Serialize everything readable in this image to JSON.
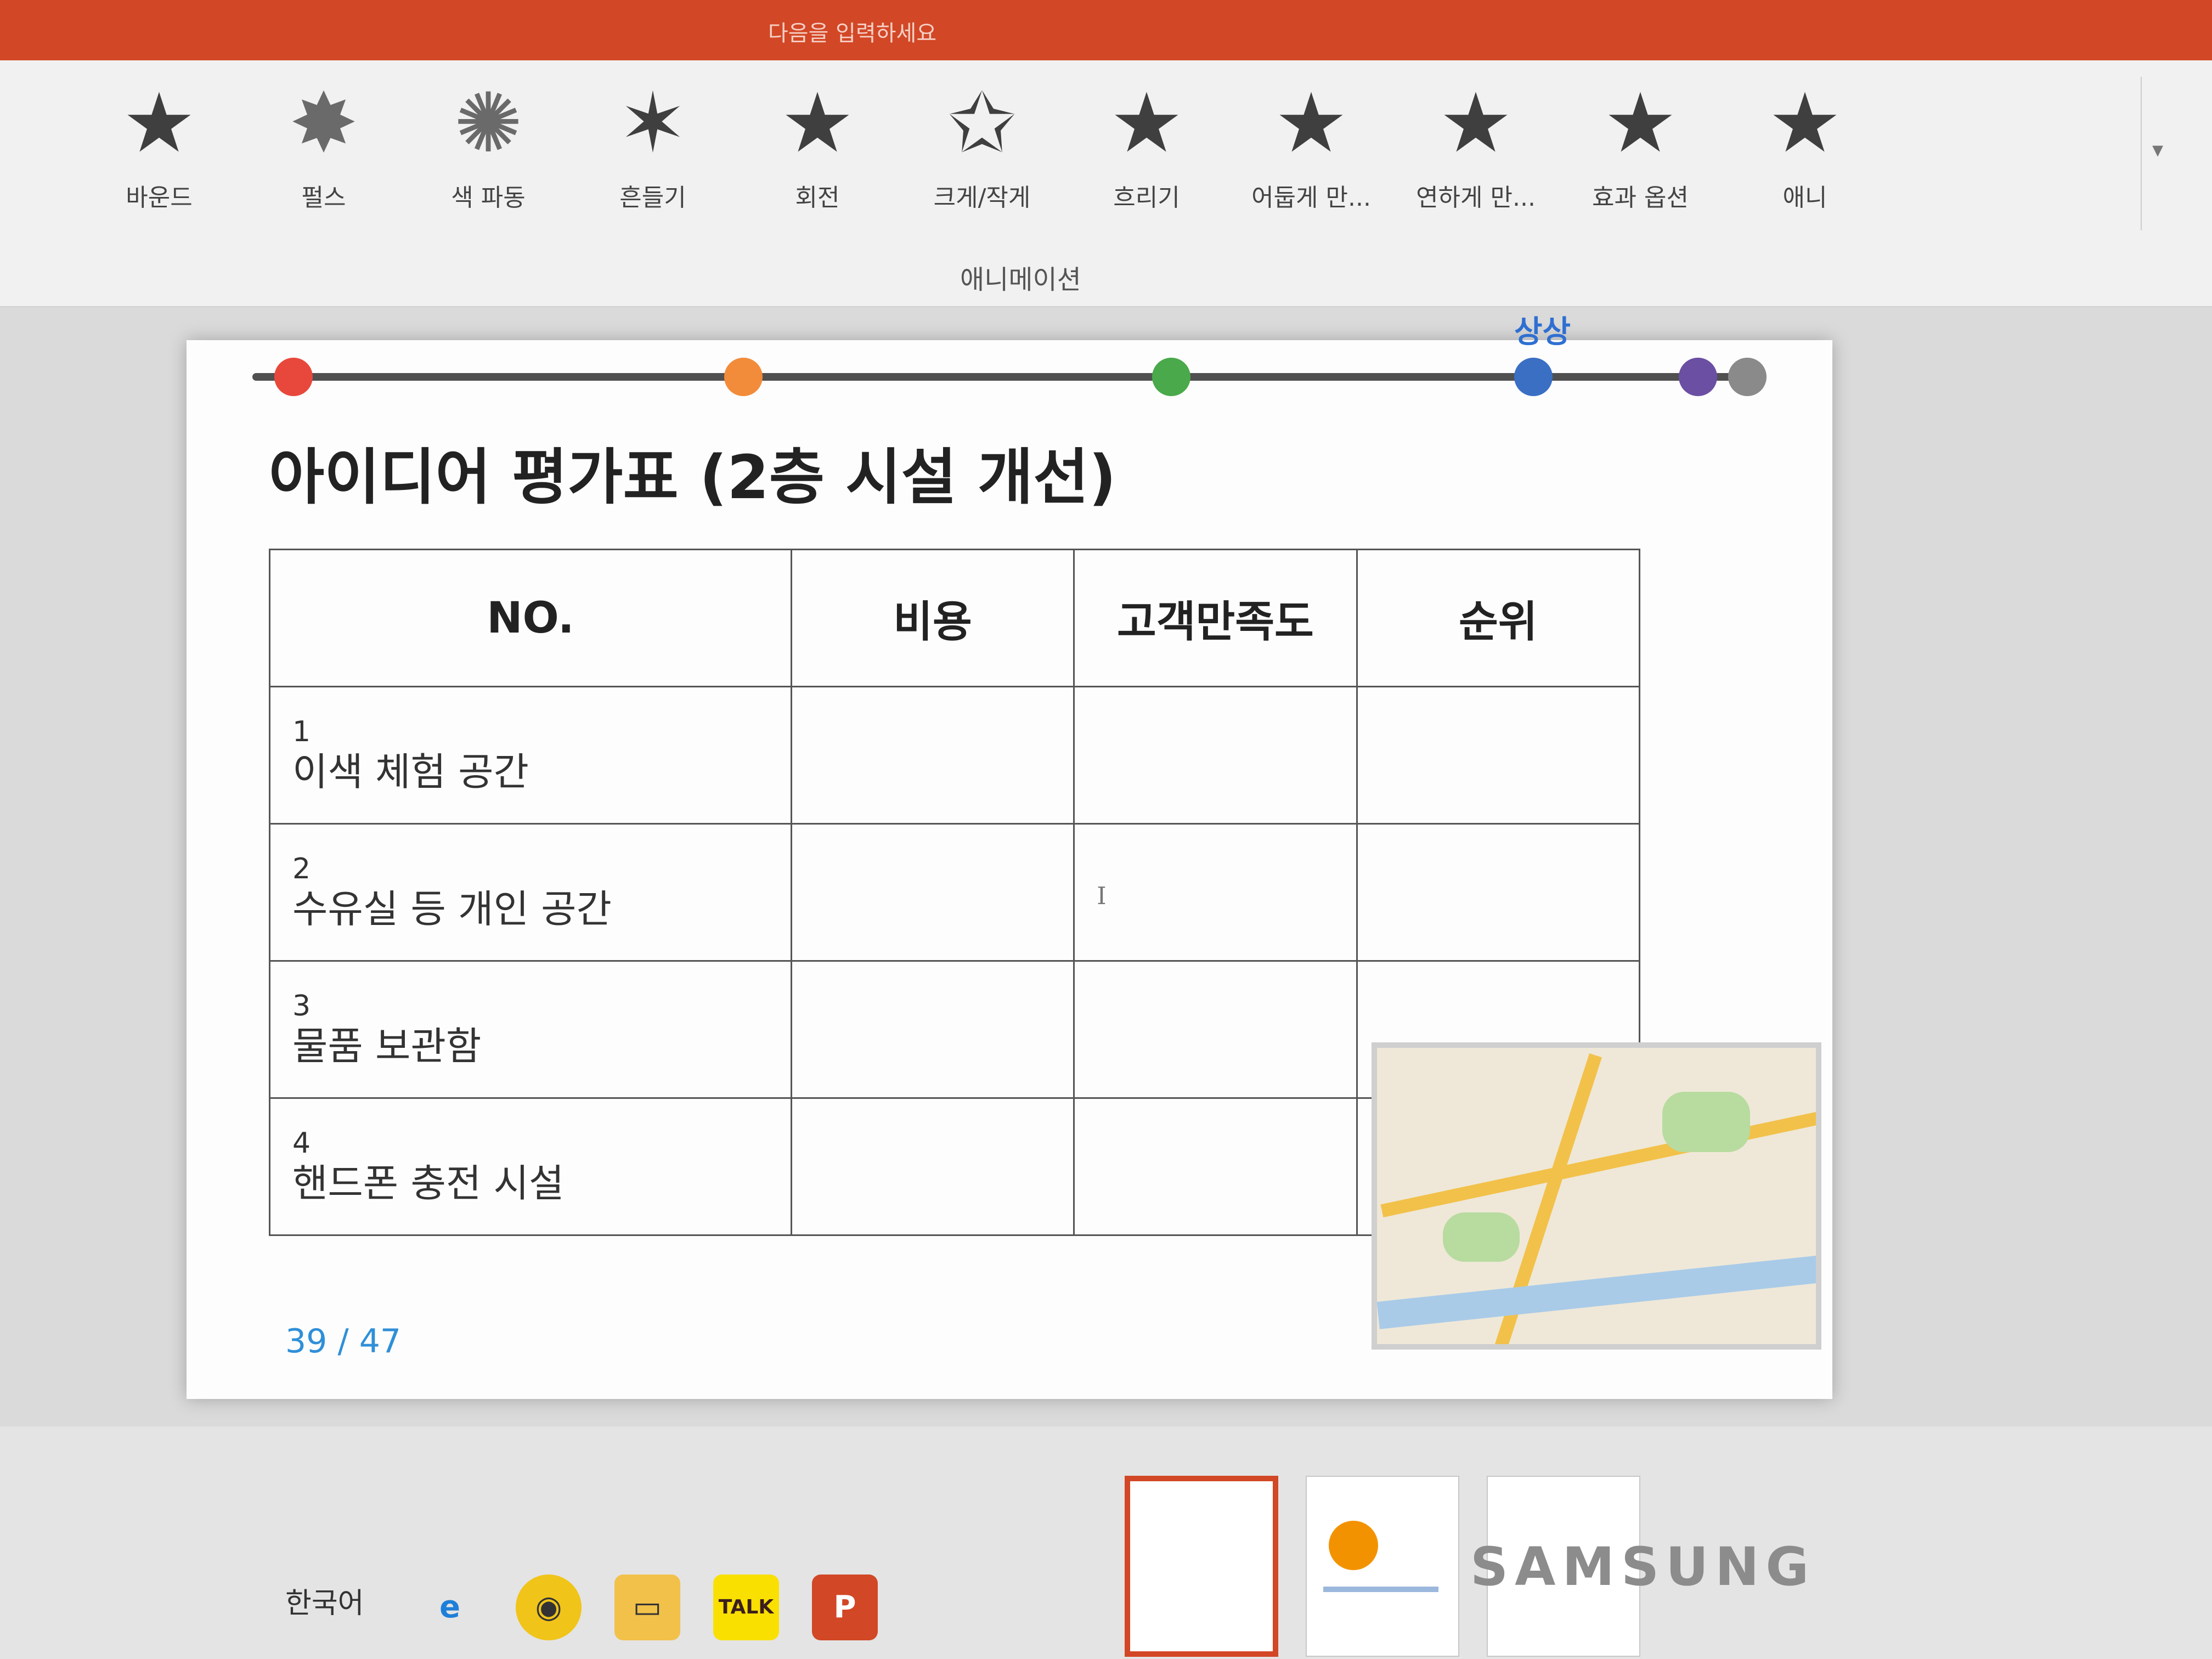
{
  "ribbon": {
    "title_text": "다음을 입력하세요",
    "group_label": "애니메이션",
    "gallery": [
      {
        "label": "바운드",
        "icon": "star-icon"
      },
      {
        "label": "펄스",
        "icon": "burst-icon"
      },
      {
        "label": "색 파동",
        "icon": "burst-icon"
      },
      {
        "label": "흔들기",
        "icon": "star-icon"
      },
      {
        "label": "회전",
        "icon": "star-icon"
      },
      {
        "label": "크게/작게",
        "icon": "star-icon"
      },
      {
        "label": "흐리기",
        "icon": "star-icon"
      },
      {
        "label": "어둡게 만...",
        "icon": "star-icon"
      },
      {
        "label": "연하게 만...",
        "icon": "star-icon"
      },
      {
        "label": "효과 옵션",
        "icon": "star-icon"
      },
      {
        "label": "애니",
        "icon": "star-icon"
      }
    ]
  },
  "slide": {
    "title": "아이디어 평가표 (2층 시설 개선)",
    "timeline_label": "상상",
    "timeline_colors": [
      "#e8483b",
      "#f28c3a",
      "#4aa94a",
      "#3a6fc4",
      "#6b4fa3",
      "#8a8a8a"
    ],
    "table": {
      "headers": [
        "NO.",
        "비용",
        "고객만족도",
        "순위"
      ],
      "rows": [
        {
          "num": "1",
          "name": "이색 체험 공간"
        },
        {
          "num": "2",
          "name": "수유실 등 개인 공간"
        },
        {
          "num": "3",
          "name": "물품 보관함"
        },
        {
          "num": "4",
          "name": "핸드폰 충전 시설"
        }
      ],
      "cursor_glyph": "I"
    },
    "page_current": "39",
    "page_separator": "/",
    "page_total": "47"
  },
  "status": {
    "language": "한국어"
  },
  "monitor": {
    "brand": "SAMSUNG"
  }
}
